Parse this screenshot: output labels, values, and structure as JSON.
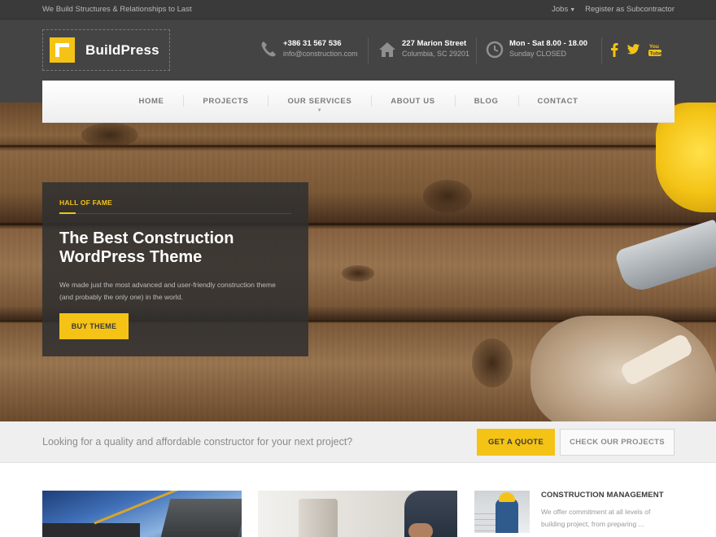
{
  "topbar": {
    "tagline": "We Build Structures & Relationships to Last",
    "links": [
      {
        "label": "Jobs",
        "has_dropdown": true
      },
      {
        "label": "Register as Subcontractor",
        "has_dropdown": false
      }
    ]
  },
  "header": {
    "logo_text": "BuildPress",
    "widgets": [
      {
        "icon": "phone-icon",
        "title": "+386 31 567 536",
        "subtitle": "info@construction.com"
      },
      {
        "icon": "home-icon",
        "title": "227 Marion Street",
        "subtitle": "Columbia, SC 29201"
      },
      {
        "icon": "clock-icon",
        "title": "Mon - Sat 8.00 - 18.00",
        "subtitle": "Sunday CLOSED"
      }
    ],
    "social": [
      {
        "icon": "facebook-icon",
        "glyph": "f"
      },
      {
        "icon": "twitter-icon",
        "glyph": "t"
      },
      {
        "icon": "youtube-icon",
        "glyph": "You Tube"
      }
    ]
  },
  "nav": {
    "items": [
      {
        "label": "HOME"
      },
      {
        "label": "PROJECTS"
      },
      {
        "label": "OUR SERVICES",
        "has_dropdown": true
      },
      {
        "label": "ABOUT US"
      },
      {
        "label": "BLOG"
      },
      {
        "label": "CONTACT"
      }
    ]
  },
  "hero": {
    "eyebrow": "HALL OF FAME",
    "heading_line1": "The Best Construction",
    "heading_line2": "WordPress Theme",
    "description": "We made just the most advanced and user-friendly construction theme (and probably the only one) in the world.",
    "button_label": "BUY THEME"
  },
  "cta": {
    "text": "Looking for a quality and affordable constructor for your next project?",
    "primary_label": "GET A QUOTE",
    "secondary_label": "CHECK OUR PROJECTS"
  },
  "service": {
    "title": "CONSTRUCTION MANAGEMENT",
    "description": "We offer commitment at all levels of building project, from preparing ..."
  },
  "colors": {
    "accent": "#f4c316",
    "dark": "#444444",
    "topbar": "#3a3a3a",
    "cta_background": "#efefef"
  }
}
